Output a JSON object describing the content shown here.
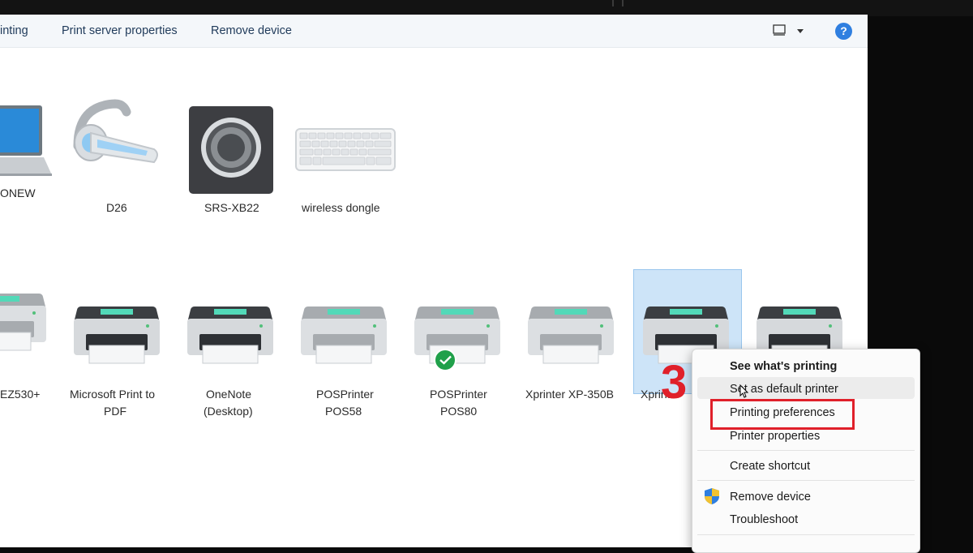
{
  "toolbar": {
    "items": [
      "inting",
      "Print server properties",
      "Remove device"
    ],
    "help_label": "?"
  },
  "devices": [
    {
      "name": "ONEW",
      "icon": "laptop-icon"
    },
    {
      "name": "D26",
      "icon": "headset-icon"
    },
    {
      "name": "SRS-XB22",
      "icon": "speaker-icon"
    },
    {
      "name": "wireless dongle",
      "icon": "keyboard-icon"
    }
  ],
  "printers": [
    {
      "line1": "EZ530+",
      "line2": ""
    },
    {
      "line1": "Microsoft Print to",
      "line2": "PDF"
    },
    {
      "line1": "OneNote",
      "line2": "(Desktop)"
    },
    {
      "line1": "POSPrinter",
      "line2": "POS58"
    },
    {
      "line1": "POSPrinter",
      "line2": "POS80",
      "default": true
    },
    {
      "line1": "Xprinter XP-350B",
      "line2": ""
    },
    {
      "line1": "Xprint",
      "line2": "",
      "selected": true
    }
  ],
  "context_menu": {
    "items": [
      "See what's printing",
      "Set as default printer",
      "Printing preferences",
      "Printer properties",
      "Create shortcut",
      "Remove device",
      "Troubleshoot"
    ]
  },
  "annotation": {
    "step": "3",
    "color": "#e0202a"
  },
  "colors": {
    "accent": "#2f7fe0",
    "selection": "#cde4f8",
    "default_check": "#20a04a"
  }
}
